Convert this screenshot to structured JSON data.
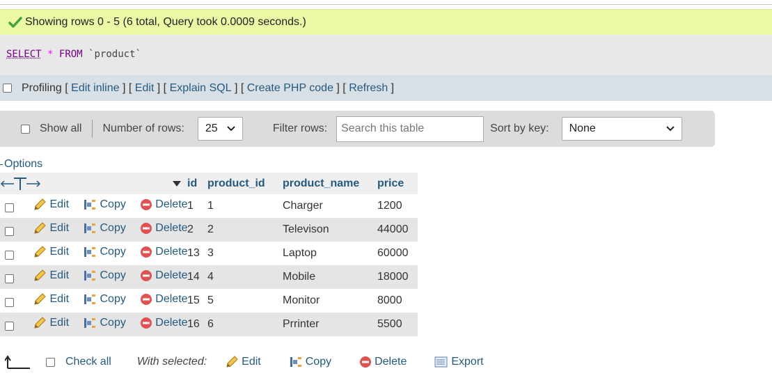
{
  "message": {
    "text": "Showing rows 0 - 5 (6 total, Query took 0.0009 seconds.)"
  },
  "sql": {
    "select": "SELECT",
    "star": "*",
    "from": "FROM",
    "table": "`product`"
  },
  "profiling": {
    "label": "Profiling",
    "links": [
      "Edit inline",
      "Edit",
      "Explain SQL",
      "Create PHP code",
      "Refresh"
    ]
  },
  "navigation": {
    "show_all": "Show all",
    "number_of_rows_label": "Number of rows:",
    "number_of_rows_value": "25",
    "filter_label": "Filter rows:",
    "filter_placeholder": "Search this table",
    "sort_label": "Sort by key:",
    "sort_value": "None"
  },
  "options_label": "Options",
  "table": {
    "columns": [
      "id",
      "product_id",
      "product_name",
      "price"
    ],
    "actions": {
      "edit": "Edit",
      "copy": "Copy",
      "delete": "Delete"
    },
    "rows": [
      {
        "id": "1",
        "product_id": "1",
        "product_name": "Charger",
        "price": "1200"
      },
      {
        "id": "2",
        "product_id": "2",
        "product_name": "Televison",
        "price": "44000"
      },
      {
        "id": "13",
        "product_id": "3",
        "product_name": "Laptop",
        "price": "60000"
      },
      {
        "id": "14",
        "product_id": "4",
        "product_name": "Mobile",
        "price": "18000"
      },
      {
        "id": "15",
        "product_id": "5",
        "product_name": "Monitor",
        "price": "8000"
      },
      {
        "id": "16",
        "product_id": "6",
        "product_name": "Prrinter",
        "price": "5500"
      }
    ]
  },
  "bottom": {
    "check_all": "Check all",
    "with_selected": "With selected:",
    "edit": "Edit",
    "copy": "Copy",
    "delete": "Delete",
    "export": "Export"
  },
  "colors": {
    "success_bg": "#ebf8a4",
    "link": "#235a81",
    "row_alt": "#e5e5e5",
    "delete_red": "#e05252"
  }
}
